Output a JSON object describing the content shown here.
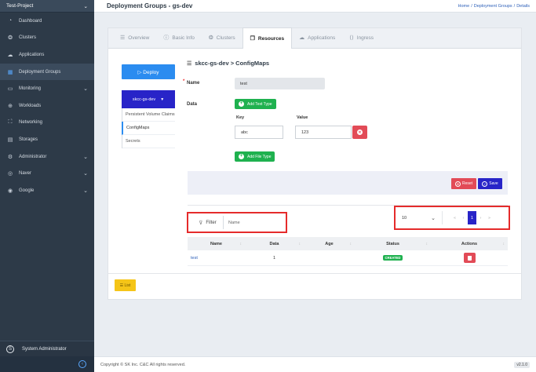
{
  "sidebar": {
    "project": "Test-Project",
    "items": [
      {
        "icon": "dashboard-icon",
        "glyph": "◔",
        "label": "Dashboard",
        "chevron": false
      },
      {
        "icon": "cluster-icon",
        "glyph": "❂",
        "label": "Clusters",
        "chevron": false
      },
      {
        "icon": "cloud-icon",
        "glyph": "☁",
        "label": "Applications",
        "chevron": false
      },
      {
        "icon": "grid-icon",
        "glyph": "▦",
        "label": "Deployment Groups",
        "chevron": false
      },
      {
        "icon": "monitor-icon",
        "glyph": "▭",
        "label": "Monitoring",
        "chevron": true
      },
      {
        "icon": "globe-icon",
        "glyph": "⊕",
        "label": "Workloads",
        "chevron": false
      },
      {
        "icon": "network-icon",
        "glyph": "⛶",
        "label": "Networking",
        "chevron": false
      },
      {
        "icon": "storage-icon",
        "glyph": "▤",
        "label": "Storages",
        "chevron": false
      },
      {
        "icon": "gear-icon",
        "glyph": "⚙",
        "label": "Administrator",
        "chevron": true
      },
      {
        "icon": "naver-icon",
        "glyph": "◎",
        "label": "Naver",
        "chevron": true
      },
      {
        "icon": "google-icon",
        "glyph": "◉",
        "label": "Google",
        "chevron": true
      }
    ],
    "user": "System Administrator",
    "user_initial": "S",
    "chevron_glyph": "⌄"
  },
  "header": {
    "title": "Deployment Groups - gs-dev",
    "breadcrumb": [
      "Home",
      "/",
      "Deployment Groups",
      "/",
      "Details"
    ]
  },
  "tabs": [
    {
      "label": "Overview",
      "glyph": "☰"
    },
    {
      "label": "Basic Info",
      "glyph": "ⓘ"
    },
    {
      "label": "Clusters",
      "glyph": "❂"
    },
    {
      "label": "Resources",
      "glyph": "❐"
    },
    {
      "label": "Applications",
      "glyph": "☁"
    },
    {
      "label": "Ingress",
      "glyph": "⟨⟩"
    }
  ],
  "left_panel": {
    "deploy_label": "▷  Deploy",
    "namespace": "skcc-gs-dev",
    "resources": [
      "Persistent Volume Claims",
      "ConfigMaps",
      "Secrets"
    ]
  },
  "form": {
    "heading": "skcc-gs-dev > ConfigMaps",
    "name_label": "Name",
    "name_value": "test",
    "data_label": "Data",
    "add_text_label": "Add Text Type",
    "key_label": "Key",
    "value_label": "Value",
    "key_value": "abc",
    "value_value": "123",
    "add_file_label": "Add File Type",
    "reset_label": "Reset",
    "save_label": "Save"
  },
  "list": {
    "filter_label": "Filter",
    "filter_placeholder": "Name",
    "per_page": "10",
    "pages": [
      "«",
      "‹",
      "1",
      "›",
      "»"
    ],
    "columns": [
      "Name",
      "Data",
      "Age",
      "Status",
      "Actions"
    ],
    "rows": [
      {
        "name": "test",
        "data": "1",
        "age": "",
        "status": "CREATED"
      }
    ],
    "list_button": "☰ List"
  },
  "footer": {
    "copyright": "Copyright © SK Inc. C&C All rights reserved.",
    "version": "v2.1.0"
  },
  "colors": {
    "sidebar": "#2d3a48",
    "primary": "#2b8cf0",
    "indigo": "#2824c8",
    "success": "#1fb14f",
    "danger": "#e24b57",
    "highlight": "#e52b2b"
  }
}
